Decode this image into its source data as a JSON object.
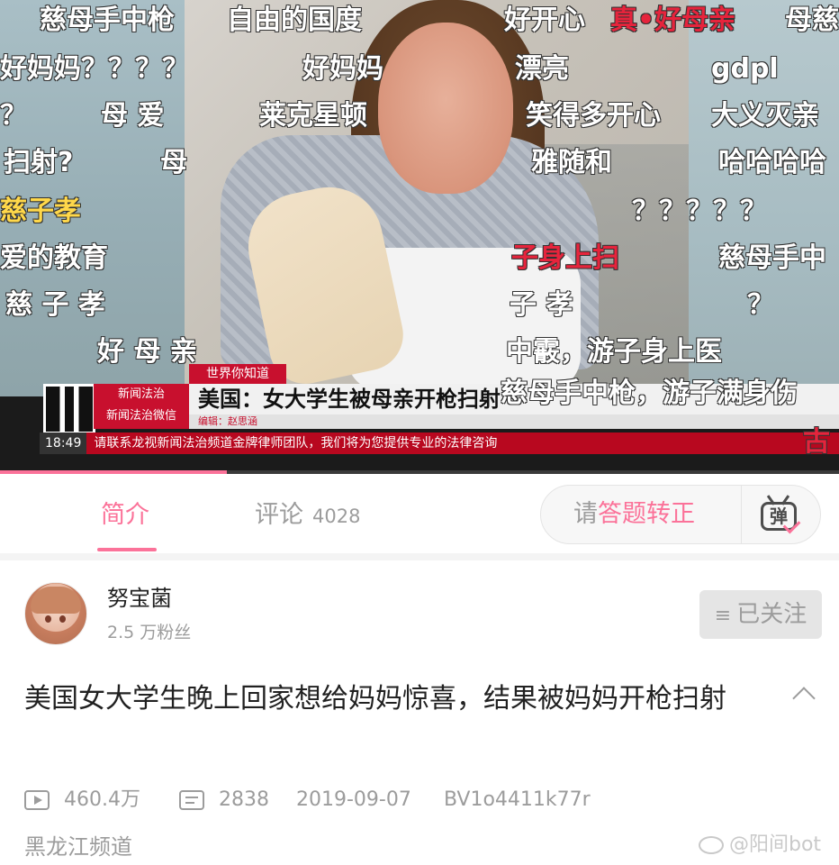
{
  "player": {
    "danmaku": [
      {
        "text": "慈母手中枪",
        "style": "white"
      },
      {
        "text": "自由的国度",
        "style": "white"
      },
      {
        "text": "好开心",
        "style": "white"
      },
      {
        "text": "真•好母亲",
        "style": "red"
      },
      {
        "text": "母慈",
        "style": "white"
      },
      {
        "text": "好妈妈？？？？",
        "style": "white"
      },
      {
        "text": "好妈妈",
        "style": "white"
      },
      {
        "text": "漂亮",
        "style": "white"
      },
      {
        "text": "gdpl",
        "style": "white"
      },
      {
        "text": "？",
        "style": "white"
      },
      {
        "text": "母 爱",
        "style": "white"
      },
      {
        "text": "莱克星顿",
        "style": "white"
      },
      {
        "text": "笑得多开心",
        "style": "white"
      },
      {
        "text": "大义灭亲",
        "style": "white"
      },
      {
        "text": "扫射?",
        "style": "white"
      },
      {
        "text": "母",
        "style": "white"
      },
      {
        "text": "雅随和",
        "style": "white"
      },
      {
        "text": "哈哈哈哈",
        "style": "white"
      },
      {
        "text": "慈子孝",
        "style": "yellow"
      },
      {
        "text": "？？？？？",
        "style": "white"
      },
      {
        "text": "爱的教育",
        "style": "white"
      },
      {
        "text": "子身上扫",
        "style": "red"
      },
      {
        "text": "慈母手中",
        "style": "white"
      },
      {
        "text": "慈 子 孝",
        "style": "white"
      },
      {
        "text": "子 孝",
        "style": "white"
      },
      {
        "text": "？",
        "style": "white"
      },
      {
        "text": "好 母 亲",
        "style": "white"
      },
      {
        "text": "中霰，游子身上医",
        "style": "white"
      },
      {
        "text": "慈母手中枪，游子满身伤",
        "style": "white"
      },
      {
        "text": "古",
        "style": "red"
      }
    ],
    "news": {
      "tag": "世界你知道",
      "logo_line1": "新闻法治",
      "logo_line2": "新闻法治微信",
      "headline": "美国：女大学生被母亲开枪扫射",
      "editor": "编辑：赵思涵",
      "time": "18:49",
      "ticker": "请联系龙视新闻法治频道金牌律师团队，我们将为您提供专业的法律咨询"
    },
    "progress": 0.27
  },
  "tabs": {
    "intro_label": "简介",
    "comments_label": "评论",
    "comments_count": "4028"
  },
  "danmaku_input": {
    "placeholder_prefix": "请",
    "placeholder_accent": "答题转正",
    "send_icon_glyph": "弹"
  },
  "uploader": {
    "name": "努宝菌",
    "fans": "2.5 万粉丝",
    "follow_label": "已关注",
    "follow_icon": "≡"
  },
  "video": {
    "title": "美国女大学生晚上回家想给妈妈惊喜，结果被妈妈开枪扫射",
    "views": "460.4万",
    "danmaku_count": "2838",
    "date": "2019-09-07",
    "bvid": "BV1o4411k77r",
    "category": "黑龙江频道"
  },
  "watermark": "@阳间bot",
  "colors": {
    "accent": "#fb7299",
    "muted": "#9c9c9c",
    "news_red": "#c8102e"
  }
}
